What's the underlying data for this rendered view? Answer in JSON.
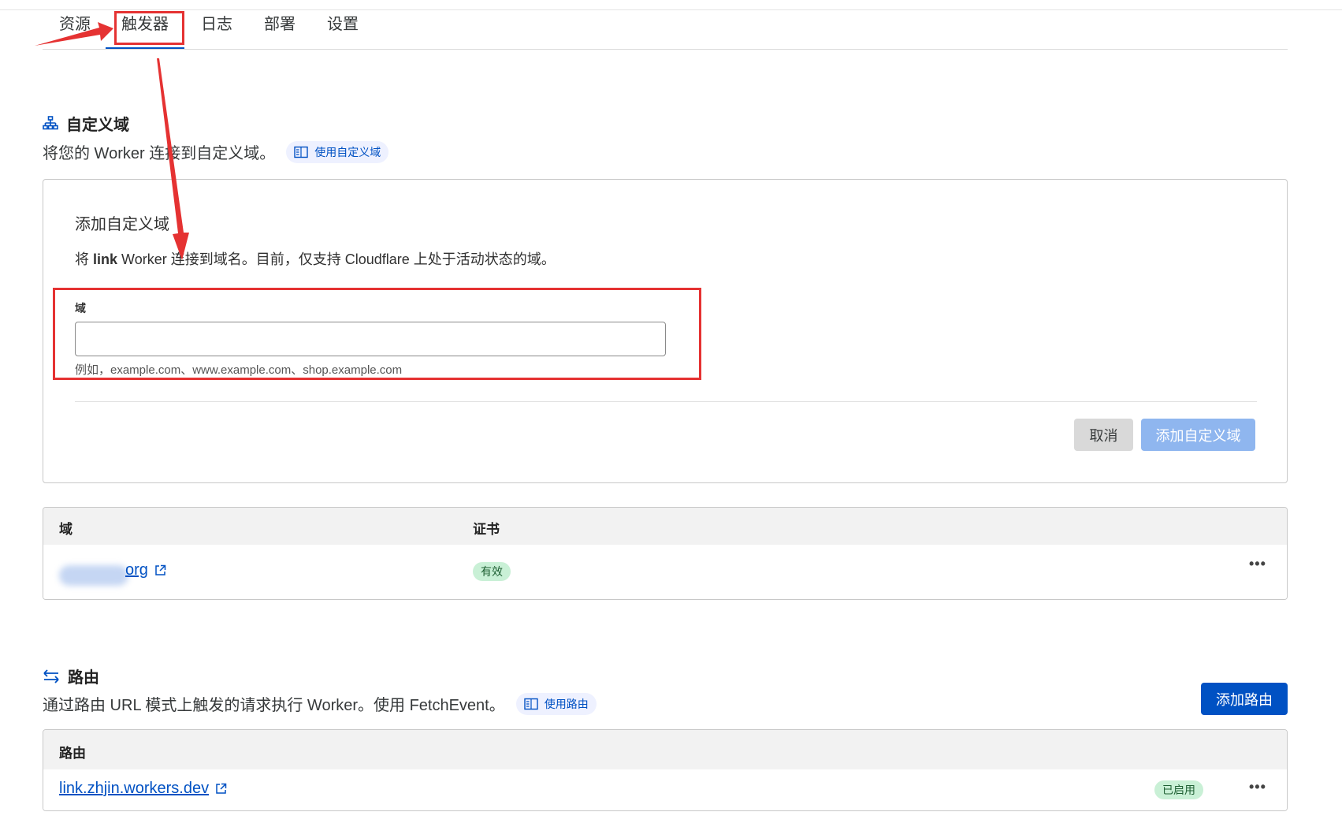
{
  "tabs": [
    {
      "label": "资源",
      "active": false
    },
    {
      "label": "触发器",
      "active": true
    },
    {
      "label": "日志",
      "active": false
    },
    {
      "label": "部署",
      "active": false
    },
    {
      "label": "设置",
      "active": false
    }
  ],
  "custom_domain": {
    "title": "自定义域",
    "description": "将您的 Worker 连接到自定义域。",
    "doc_link": "使用自定义域",
    "form": {
      "title": "添加自定义域",
      "desc_prefix": "将 ",
      "worker_name": "link",
      "desc_suffix": " Worker 连接到域名。目前，仅支持 Cloudflare 上处于活动状态的域。",
      "field_label": "域",
      "field_value": "",
      "field_hint": "例如，example.com、www.example.com、shop.example.com",
      "cancel_label": "取消",
      "submit_label": "添加自定义域"
    },
    "table": {
      "col_domain": "域",
      "col_cert": "证书",
      "rows": [
        {
          "domain": "org",
          "cert_status": "有效"
        }
      ]
    }
  },
  "routes": {
    "title": "路由",
    "description": "通过路由 URL 模式上触发的请求执行 Worker。使用 FetchEvent。",
    "doc_link": "使用路由",
    "add_label": "添加路由",
    "table": {
      "col_route": "路由",
      "rows": [
        {
          "route": "link.zhjin.workers.dev",
          "status": "已启用"
        }
      ]
    }
  },
  "colors": {
    "accent": "#0051c3",
    "annotation": "#e53232",
    "badge_bg": "#c9f0d6"
  },
  "icons": {
    "custom_domain": "sitemap-icon",
    "routes": "swap-arrows-icon",
    "doc": "book-icon",
    "external": "external-link-icon",
    "more": "more-dots-icon"
  }
}
